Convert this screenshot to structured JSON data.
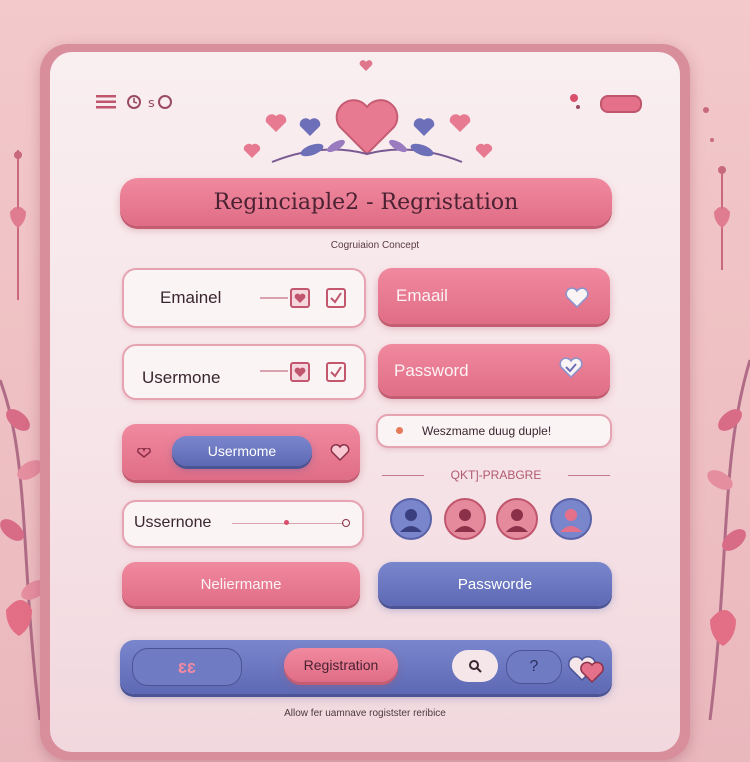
{
  "header": {
    "title": "Reginciaple2 - Regristation",
    "subtitle": "Cogruiaion Concept"
  },
  "left_fields": [
    {
      "label": "Emainel"
    },
    {
      "label": "Usermone"
    }
  ],
  "right_fields": [
    {
      "label": "Emaail"
    },
    {
      "label": "Password"
    }
  ],
  "username_button": {
    "label": "Usermome"
  },
  "notice": {
    "text": "Weszmame duug duple!"
  },
  "divider_label": "QKT]-PRABGRE",
  "slider_field": {
    "label": "Ussernone"
  },
  "bottom_buttons": {
    "left": "Neliermame",
    "right": "Passworde"
  },
  "footer_bar": {
    "badge": "ԑԑ",
    "register": "Registration",
    "help": "?"
  },
  "footer_note": "Allow fer uamnave rogistster reribice",
  "colors": {
    "pink": "#e06d86",
    "blue": "#5d69b4",
    "background": "#f3c9cb",
    "panel": "#f9eef0"
  },
  "icons": [
    "menu-icon",
    "clock-icon",
    "settings-icon",
    "heart-icon",
    "checkbox-icon",
    "avatar-icon",
    "search-icon",
    "help-icon"
  ]
}
